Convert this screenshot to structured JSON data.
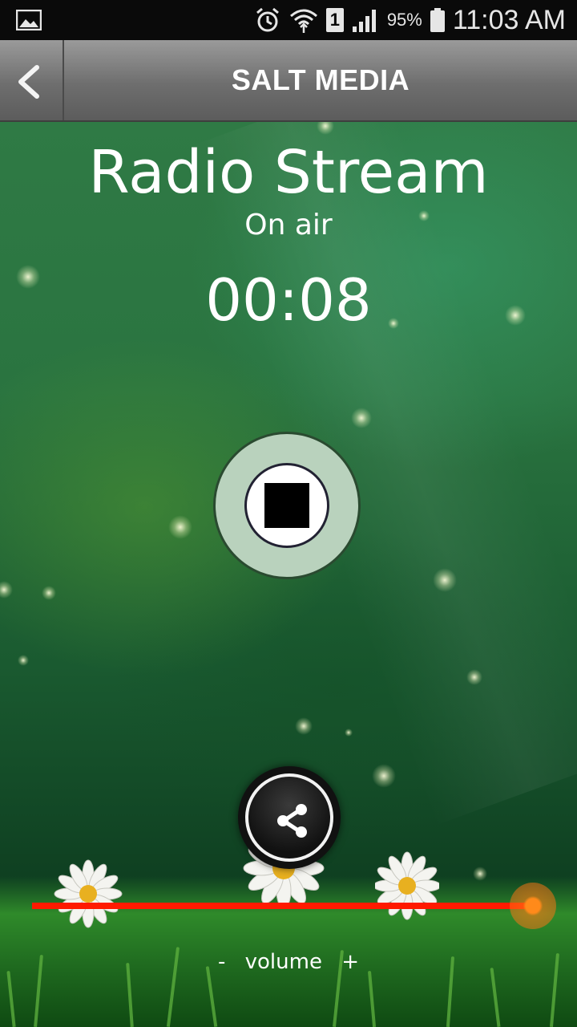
{
  "status_bar": {
    "battery_percent": "95%",
    "sim_slot": "1",
    "time": "11:03 AM",
    "icons": [
      "gallery-icon",
      "alarm-icon",
      "wifi-icon",
      "sim-icon",
      "signal-icon",
      "battery-icon"
    ]
  },
  "toolbar": {
    "title": "SALT MEDIA",
    "back_icon": "chevron-left-icon"
  },
  "player": {
    "title": "Radio Stream",
    "status": "On air",
    "elapsed": "00:08",
    "control_icon": "stop-icon"
  },
  "share": {
    "icon": "share-icon"
  },
  "volume": {
    "minus": "-",
    "label": "volume",
    "plus": "+",
    "level": 1.0,
    "track_color": "#ff1a00",
    "thumb_color": "#ff8a1a"
  },
  "colors": {
    "toolbar_bg": "#7a7a7a",
    "background_green": "#2a7440"
  }
}
